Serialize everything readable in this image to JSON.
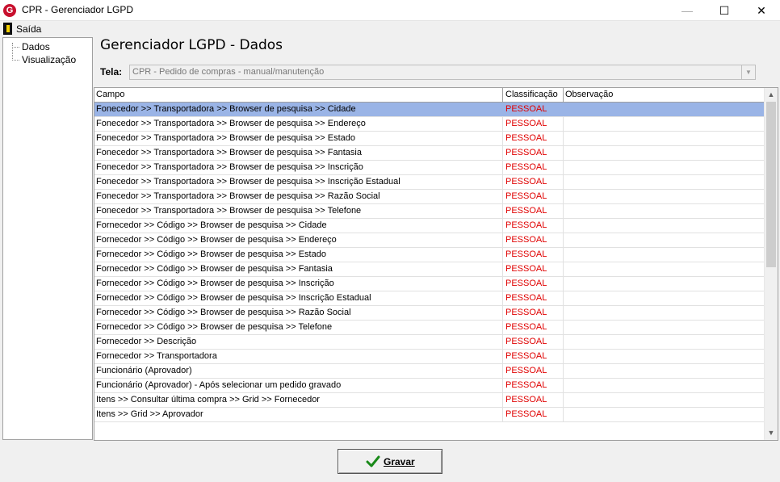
{
  "window": {
    "title": "CPR - Gerenciador LGPD",
    "icon": "app-logo-icon",
    "controls": [
      "minimize",
      "maximize",
      "close"
    ]
  },
  "menu": {
    "exit_label": "Saída"
  },
  "tree": {
    "items": [
      {
        "label": "Dados"
      },
      {
        "label": "Visualização"
      }
    ]
  },
  "page": {
    "title": "Gerenciador LGPD - Dados",
    "tela_label": "Tela:",
    "tela_value": "CPR - Pedido de compras - manual/manutenção"
  },
  "grid": {
    "columns": [
      "Campo",
      "Classificação",
      "Observação"
    ],
    "selected_row": 0,
    "classification_color": "#e00000",
    "selection_color": "#9ab4e6",
    "rows": [
      {
        "campo": "Fonecedor >> Transportadora >> Browser de pesquisa >> Cidade",
        "classificacao": "PESSOAL",
        "observacao": ""
      },
      {
        "campo": "Fonecedor >> Transportadora >> Browser de pesquisa >> Endereço",
        "classificacao": "PESSOAL",
        "observacao": ""
      },
      {
        "campo": "Fonecedor >> Transportadora >> Browser de pesquisa >> Estado",
        "classificacao": "PESSOAL",
        "observacao": ""
      },
      {
        "campo": "Fonecedor >> Transportadora >> Browser de pesquisa >> Fantasia",
        "classificacao": "PESSOAL",
        "observacao": ""
      },
      {
        "campo": "Fonecedor >> Transportadora >> Browser de pesquisa >> Inscrição",
        "classificacao": "PESSOAL",
        "observacao": ""
      },
      {
        "campo": "Fonecedor >> Transportadora >> Browser de pesquisa >> Inscrição Estadual",
        "classificacao": "PESSOAL",
        "observacao": ""
      },
      {
        "campo": "Fonecedor >> Transportadora >> Browser de pesquisa >> Razão Social",
        "classificacao": "PESSOAL",
        "observacao": ""
      },
      {
        "campo": "Fonecedor >> Transportadora >> Browser de pesquisa >> Telefone",
        "classificacao": "PESSOAL",
        "observacao": ""
      },
      {
        "campo": "Fornecedor >> Código >> Browser de pesquisa >> Cidade",
        "classificacao": "PESSOAL",
        "observacao": ""
      },
      {
        "campo": "Fornecedor >> Código >> Browser de pesquisa >> Endereço",
        "classificacao": "PESSOAL",
        "observacao": ""
      },
      {
        "campo": "Fornecedor >> Código >> Browser de pesquisa >> Estado",
        "classificacao": "PESSOAL",
        "observacao": ""
      },
      {
        "campo": "Fornecedor >> Código >> Browser de pesquisa >> Fantasia",
        "classificacao": "PESSOAL",
        "observacao": ""
      },
      {
        "campo": "Fornecedor >> Código >> Browser de pesquisa >> Inscrição",
        "classificacao": "PESSOAL",
        "observacao": ""
      },
      {
        "campo": "Fornecedor >> Código >> Browser de pesquisa >> Inscrição Estadual",
        "classificacao": "PESSOAL",
        "observacao": ""
      },
      {
        "campo": "Fornecedor >> Código >> Browser de pesquisa >> Razão Social",
        "classificacao": "PESSOAL",
        "observacao": ""
      },
      {
        "campo": "Fornecedor >> Código >> Browser de pesquisa >> Telefone",
        "classificacao": "PESSOAL",
        "observacao": ""
      },
      {
        "campo": "Fornecedor >> Descrição",
        "classificacao": "PESSOAL",
        "observacao": ""
      },
      {
        "campo": "Fornecedor >> Transportadora",
        "classificacao": "PESSOAL",
        "observacao": ""
      },
      {
        "campo": "Funcionário (Aprovador)",
        "classificacao": "PESSOAL",
        "observacao": ""
      },
      {
        "campo": "Funcionário (Aprovador) -  Após selecionar um pedido gravado",
        "classificacao": "PESSOAL",
        "observacao": ""
      },
      {
        "campo": "Itens >> Consultar última compra >> Grid >> Fornecedor",
        "classificacao": "PESSOAL",
        "observacao": ""
      },
      {
        "campo": "Itens >> Grid >> Aprovador",
        "classificacao": "PESSOAL",
        "observacao": ""
      }
    ]
  },
  "footer": {
    "save_label": "Gravar",
    "save_icon": "checkmark-icon"
  }
}
